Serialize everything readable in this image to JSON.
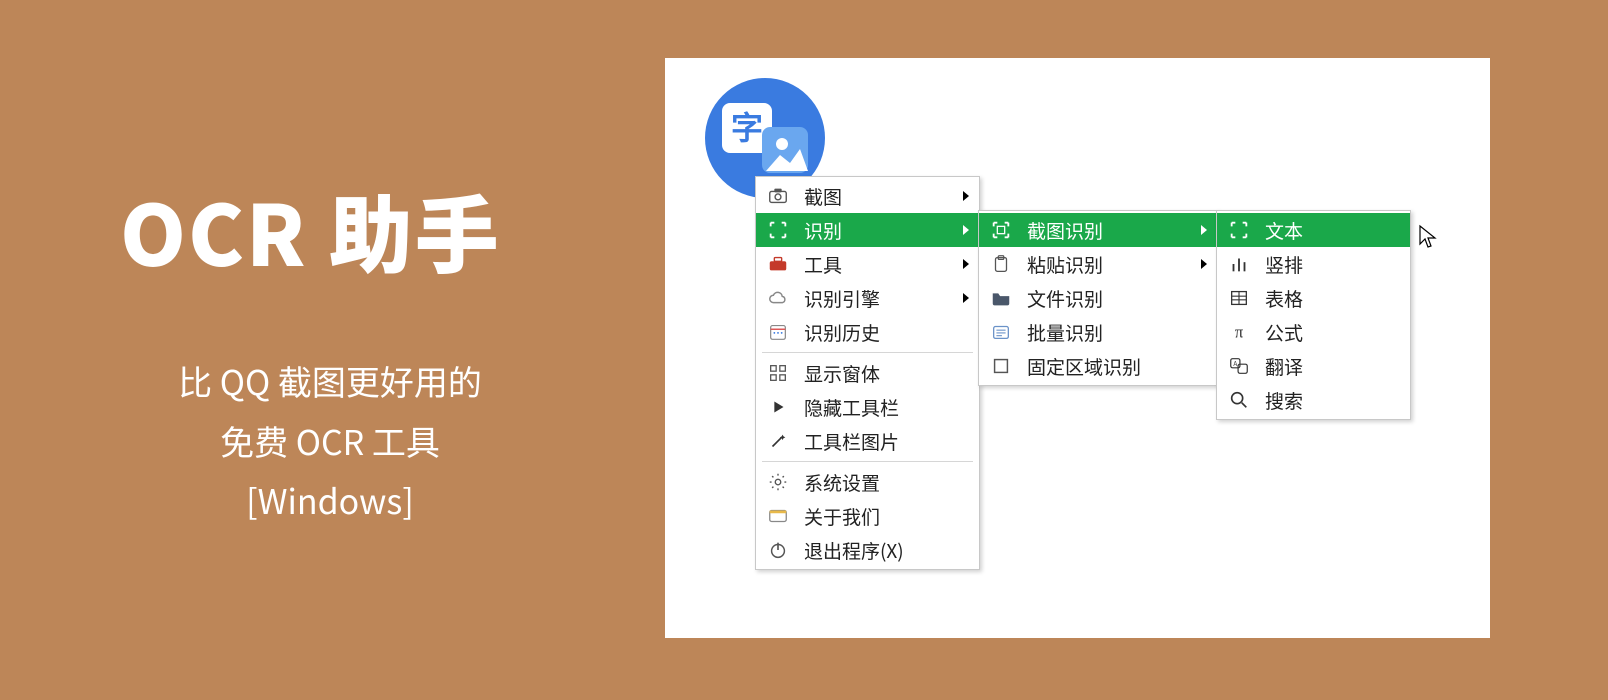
{
  "promo": {
    "title": "OCR 助手",
    "line1": "比 QQ 截图更好用的",
    "line2": "免费 OCR 工具",
    "line3": "[Windows]"
  },
  "logo_char": "字",
  "menu1": {
    "items": [
      {
        "label": "截图",
        "icon": "camera",
        "submenu": true,
        "highlight": false
      },
      {
        "label": "识别",
        "icon": "scan",
        "submenu": true,
        "highlight": true
      },
      {
        "label": "工具",
        "icon": "toolbox",
        "submenu": true,
        "highlight": false
      },
      {
        "label": "识别引擎",
        "icon": "cloud",
        "submenu": true,
        "highlight": false
      },
      {
        "label": "识别历史",
        "icon": "calendar",
        "submenu": false,
        "highlight": false
      }
    ],
    "items2": [
      {
        "label": "显示窗体",
        "icon": "grid",
        "submenu": false
      },
      {
        "label": "隐藏工具栏",
        "icon": "play",
        "submenu": false
      },
      {
        "label": "工具栏图片",
        "icon": "wand",
        "submenu": false
      }
    ],
    "items3": [
      {
        "label": "系统设置",
        "icon": "gear",
        "submenu": false
      },
      {
        "label": "关于我们",
        "icon": "card",
        "submenu": false
      },
      {
        "label": "退出程序(X)",
        "icon": "power",
        "submenu": false
      }
    ]
  },
  "menu2": {
    "items": [
      {
        "label": "截图识别",
        "icon": "scan",
        "submenu": true,
        "highlight": true
      },
      {
        "label": "粘贴识别",
        "icon": "paste",
        "submenu": true,
        "highlight": false
      },
      {
        "label": "文件识别",
        "icon": "folder",
        "submenu": false,
        "highlight": false
      },
      {
        "label": "批量识别",
        "icon": "batch",
        "submenu": false,
        "highlight": false
      },
      {
        "label": "固定区域识别",
        "icon": "square",
        "submenu": false,
        "highlight": false
      }
    ]
  },
  "menu3": {
    "items": [
      {
        "label": "文本",
        "icon": "scan",
        "highlight": true
      },
      {
        "label": "竖排",
        "icon": "bars",
        "highlight": false
      },
      {
        "label": "表格",
        "icon": "table",
        "highlight": false
      },
      {
        "label": "公式",
        "icon": "pi",
        "highlight": false
      },
      {
        "label": "翻译",
        "icon": "translate",
        "highlight": false
      },
      {
        "label": "搜索",
        "icon": "search",
        "highlight": false
      }
    ]
  }
}
